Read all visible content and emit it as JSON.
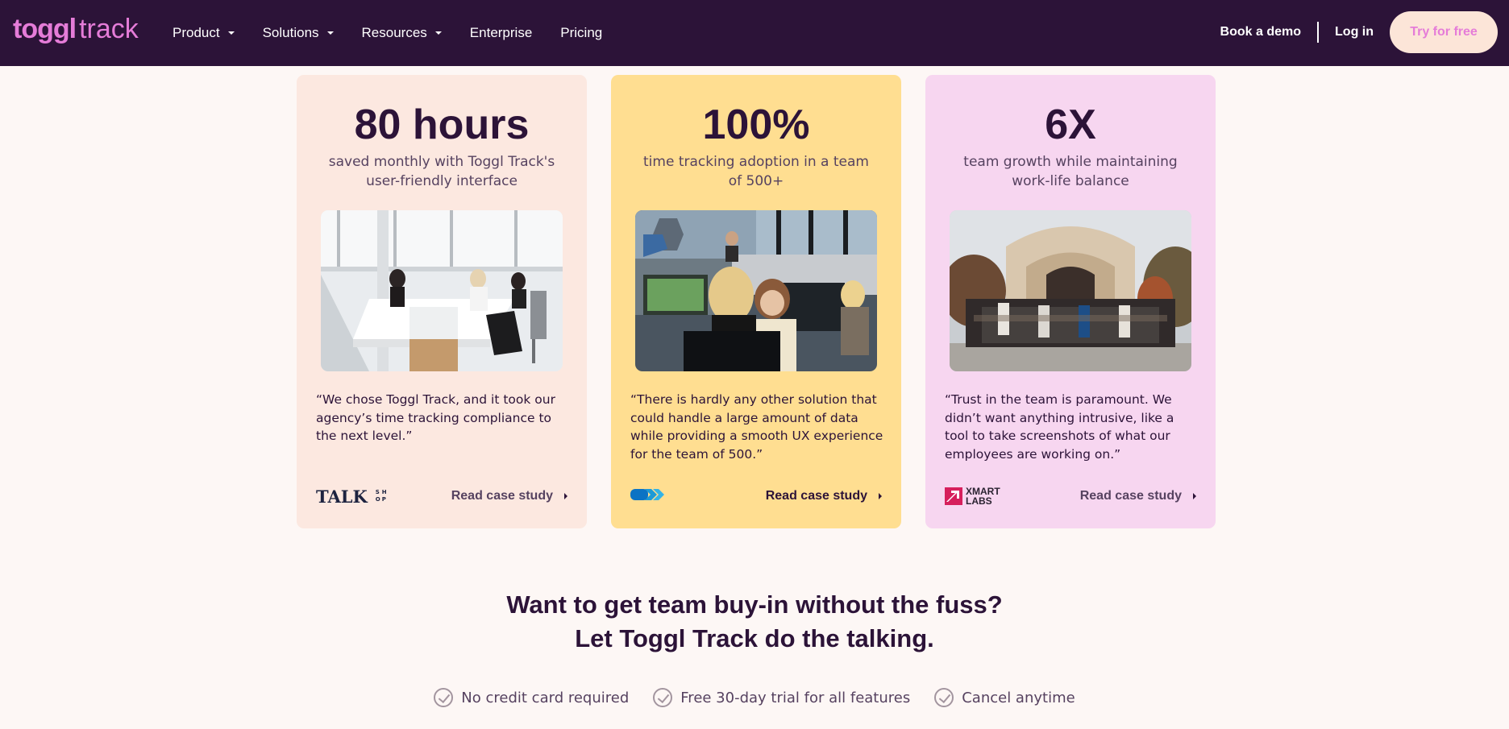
{
  "nav": {
    "logo_bold": "toggl",
    "logo_light": "track",
    "items": [
      {
        "label": "Product",
        "has_dropdown": true
      },
      {
        "label": "Solutions",
        "has_dropdown": true
      },
      {
        "label": "Resources",
        "has_dropdown": true
      },
      {
        "label": "Enterprise",
        "has_dropdown": false
      },
      {
        "label": "Pricing",
        "has_dropdown": false
      }
    ],
    "book_demo": "Book a demo",
    "login": "Log in",
    "try_free": "Try for free"
  },
  "cards": [
    {
      "stat": "80 hours",
      "subtitle": "saved monthly with Toggl Track's user-friendly interface",
      "quote": "“We chose Toggl Track, and it took our agency’s time tracking compliance to the next level.”",
      "link": "Read case study",
      "logo_text": "TALK",
      "logo_small": [
        "S",
        "H",
        "O",
        "P"
      ],
      "color": "#fce8e0"
    },
    {
      "stat": "100%",
      "subtitle": "time tracking adoption in a team of 500+",
      "quote": "“There is hardly any other solution that could handle a large amount of data while providing a smooth UX experience for the team of 500.”",
      "link": "Read case study",
      "color": "#ffde91"
    },
    {
      "stat": "6X",
      "subtitle": "team growth while maintaining work-life balance",
      "quote": "“Trust in the team is paramount. We didn’t want anything intrusive, like a tool to take screenshots of what our employees are working on.”",
      "link": "Read case study",
      "logo_text_1": "XMART",
      "logo_text_2": "LABS",
      "color": "#f7d6f0"
    }
  ],
  "cta": {
    "line1": "Want to get team buy-in without the fuss?",
    "line2": "Let Toggl Track do the talking."
  },
  "perks": [
    "No credit card required",
    "Free 30-day trial for all features",
    "Cancel anytime"
  ],
  "colors": {
    "nav_bg": "#2c1338",
    "brand_pink": "#e57cd8",
    "page_bg": "#fdf7f5"
  }
}
